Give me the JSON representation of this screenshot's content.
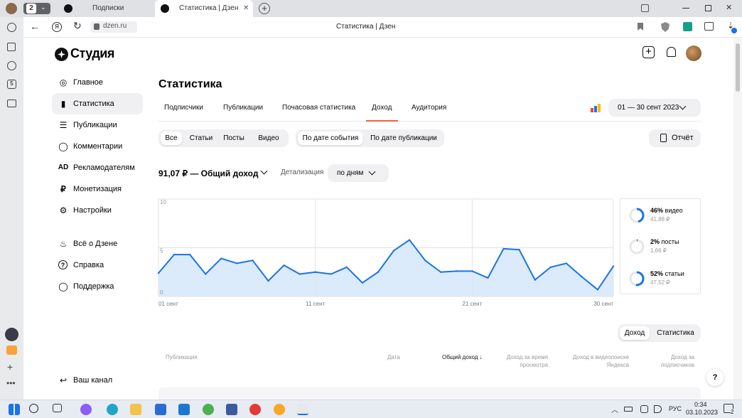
{
  "browser": {
    "tab_count": "2",
    "tabs": [
      {
        "title": "Подписки"
      },
      {
        "title": "Статистика | Дзен"
      }
    ],
    "url": "dzen.ru",
    "page_title": "Статистика | Дзен"
  },
  "studio": {
    "logo": "Студия",
    "nav": [
      {
        "label": "Главное",
        "icon": "planet-icon"
      },
      {
        "label": "Статистика",
        "icon": "bar-chart-icon",
        "selected": true
      },
      {
        "label": "Публикации",
        "icon": "layers-icon"
      },
      {
        "label": "Комментарии",
        "icon": "comment-icon"
      },
      {
        "label": "Рекламодателям",
        "icon": "ad-icon"
      },
      {
        "label": "Монетизация",
        "icon": "ruble-icon"
      },
      {
        "label": "Настройки",
        "icon": "gear-icon"
      },
      {
        "label": "Всё о Дзене",
        "icon": "flame-icon"
      },
      {
        "label": "Справка",
        "icon": "question-icon"
      },
      {
        "label": "Поддержка",
        "icon": "chat-icon"
      }
    ],
    "ad_glyph": "AD",
    "ruble_glyph": "₽",
    "your_channel": "Ваш канал"
  },
  "main": {
    "title": "Статистика",
    "tabs": [
      "Подписчики",
      "Публикации",
      "Почасовая статистика",
      "Доход",
      "Аудитория"
    ],
    "active_tab": "Доход",
    "date_range": "01 — 30 сент 2023",
    "filters_type": [
      "Все",
      "Статьи",
      "Посты",
      "Видео"
    ],
    "filters_date": [
      "По дате события",
      "По дате публикации"
    ],
    "report_button": "Отчёт",
    "total": "91,07 ₽ — Общий доход",
    "detail_label": "Детализация",
    "detail_value": "по дням",
    "bottom_toggle": [
      "Доход",
      "Статистика"
    ],
    "table_headers": {
      "publication": "Публикация",
      "date": "Дата",
      "total_income": "Общий доход",
      "sort_arrow": "↓",
      "income_watch": "Доход за время просмотра",
      "income_search": "Доход в видеопоиске Яндекса",
      "income_subs": "Доход за подписчиков"
    },
    "help": "?"
  },
  "chart_data": {
    "type": "area",
    "x_tick_labels": [
      "01 сент",
      "11 сент",
      "21 сент",
      "30 сент"
    ],
    "y_tick_labels": [
      "10",
      "5",
      "0"
    ],
    "ylim": [
      0,
      10
    ],
    "grid": true,
    "color": "#1a73e8",
    "fill": "#dcebfb",
    "x": [
      1,
      2,
      3,
      4,
      5,
      6,
      7,
      8,
      9,
      10,
      11,
      12,
      13,
      14,
      15,
      16,
      17,
      18,
      19,
      20,
      21,
      22,
      23,
      24,
      25,
      26,
      27,
      28,
      29,
      30
    ],
    "values": [
      2.4,
      4.3,
      4.3,
      2.3,
      3.9,
      3.4,
      3.7,
      1.6,
      3.2,
      2.3,
      2.5,
      2.3,
      3.0,
      1.4,
      2.5,
      4.7,
      5.8,
      3.7,
      2.5,
      2.6,
      2.6,
      1.9,
      4.9,
      4.8,
      1.7,
      3.0,
      3.4,
      2.0,
      0.7,
      3.1
    ]
  },
  "breakdown": [
    {
      "pct": "46%",
      "kind": "видео",
      "amount": "41,88 ₽",
      "fraction": 0.46
    },
    {
      "pct": "2%",
      "kind": "посты",
      "amount": "1,66 ₽",
      "fraction": 0.02
    },
    {
      "pct": "52%",
      "kind": "статьи",
      "amount": "47,52 ₽",
      "fraction": 0.52
    }
  ],
  "taskbar": {
    "time": "0:34",
    "date": "03.10.2023",
    "lang": "РУС",
    "notif_count": "2"
  },
  "colors": {
    "accent": "#ff5a32",
    "blue": "#1a73e8"
  }
}
